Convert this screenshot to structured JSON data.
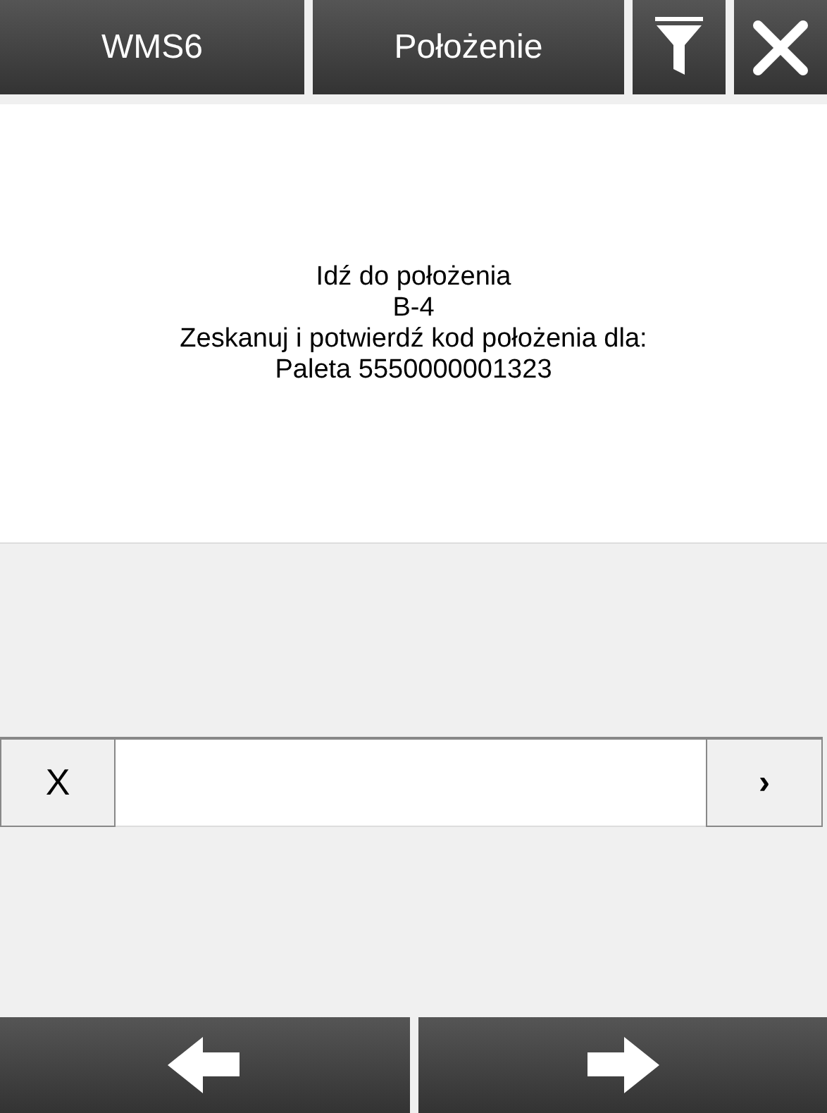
{
  "header": {
    "app_title": "WMS6",
    "screen_title": "Położenie"
  },
  "message": [
    "Idź do położenia",
    "B-4",
    "Zeskanuj i potwierdź kod położenia dla:",
    "Paleta 5550000001323"
  ],
  "scan_row": {
    "clear_label": "X",
    "submit_label": "›"
  }
}
